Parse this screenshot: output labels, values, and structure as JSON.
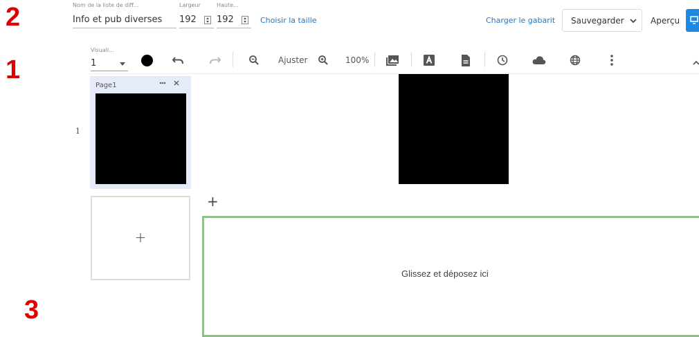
{
  "annotations": {
    "one": "1",
    "two": "2",
    "three": "3"
  },
  "topbar": {
    "list_name_label": "Nom de la liste de diff...",
    "list_name_value": "Info et pub diverses",
    "width_label": "Largeur",
    "width_value": "192",
    "height_label": "Haute...",
    "height_value": "192",
    "choose_size": "Choisir la taille",
    "load_template": "Charger le gabarit",
    "save_label": "Sauvegarder",
    "preview_label": "Aperçu"
  },
  "toolbar": {
    "view_label": "Visuali...",
    "view_value": "1",
    "fit_label": "Ajuster",
    "zoom_value": "100%"
  },
  "pages_panel": {
    "page_label": "Page1",
    "row_number": "1",
    "add_symbol": "+"
  },
  "canvas": {
    "add_symbol": "+",
    "drop_text": "Glissez et déposez ici"
  },
  "colors": {
    "accent": "#1e77c8",
    "dropzone_border": "#8fbf8a",
    "page_highlight": "#e6ebfa",
    "annotation": "#e00000"
  }
}
